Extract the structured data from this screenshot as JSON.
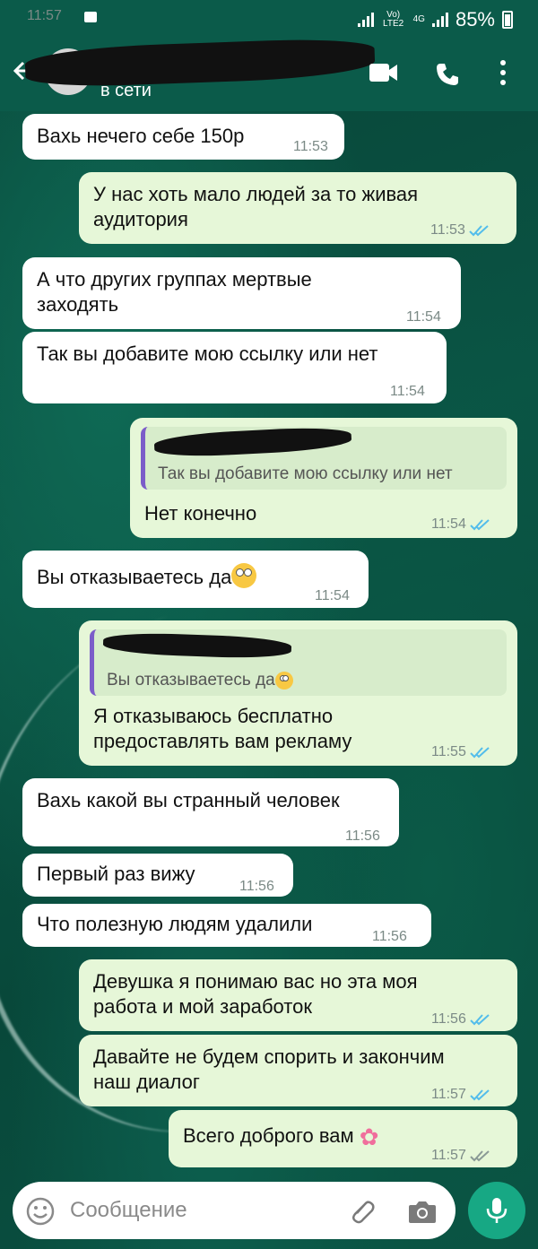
{
  "status_bar": {
    "time": "11:57",
    "network_label": "Vo) LTE2",
    "network_4g": "4G",
    "battery": "85%"
  },
  "header": {
    "contact_status": "в сети"
  },
  "messages": [
    {
      "dir": "in",
      "text": "Вахь нечего себе 150р",
      "time": "11:53"
    },
    {
      "dir": "out",
      "text": "У нас хоть мало людей за то живая аудитория",
      "time": "11:53"
    },
    {
      "dir": "in",
      "text": "А что других группах мертвые заходять",
      "time": "11:54"
    },
    {
      "dir": "in",
      "text": "Так вы добавите мою ссылку или нет",
      "time": "11:54"
    },
    {
      "dir": "out",
      "quote": "Так вы добавите мою ссылку или нет",
      "text": "Нет конечно",
      "time": "11:54"
    },
    {
      "dir": "in",
      "text": "Вы отказываетесь да",
      "time": "11:54"
    },
    {
      "dir": "out",
      "quote": "Вы отказываетесь да",
      "text": "Я отказываюсь бесплатно предоставлять вам рекламу",
      "time": "11:55"
    },
    {
      "dir": "in",
      "text": "Вахь какой вы странный человек",
      "time": "11:56"
    },
    {
      "dir": "in",
      "text": "Первый раз вижу",
      "time": "11:56"
    },
    {
      "dir": "in",
      "text": "Что полезную людям удалили",
      "time": "11:56"
    },
    {
      "dir": "out",
      "text": "Девушка я понимаю вас но эта моя работа и мой заработок",
      "time": "11:56"
    },
    {
      "dir": "out",
      "text": "Давайте не будем спорить и закончим наш диалог",
      "time": "11:57"
    },
    {
      "dir": "out",
      "text": "Всего доброго вам",
      "time": "11:57"
    }
  ],
  "message_lines": {
    "m1_l1": "У нас хоть мало людей за то живая",
    "m1_l2": "аудитория",
    "m2_l1": "А что других группах мертвые",
    "m2_l2": "заходять",
    "m6_l1": "Я отказываюсь бесплатно",
    "m6_l2": "предоставлять вам рекламу",
    "m10_l1": "Девушка я понимаю вас но эта моя",
    "m10_l2": "работа и мой заработок",
    "m11_l1": "Давайте не будем спорить и закончим",
    "m11_l2": "наш диалог"
  },
  "input": {
    "placeholder": "Сообщение"
  },
  "colors": {
    "header": "#0b5b4a",
    "incoming": "#ffffff",
    "outgoing": "#e6f7d8",
    "read_ticks": "#53bdeb",
    "mic_button": "#17a884"
  }
}
